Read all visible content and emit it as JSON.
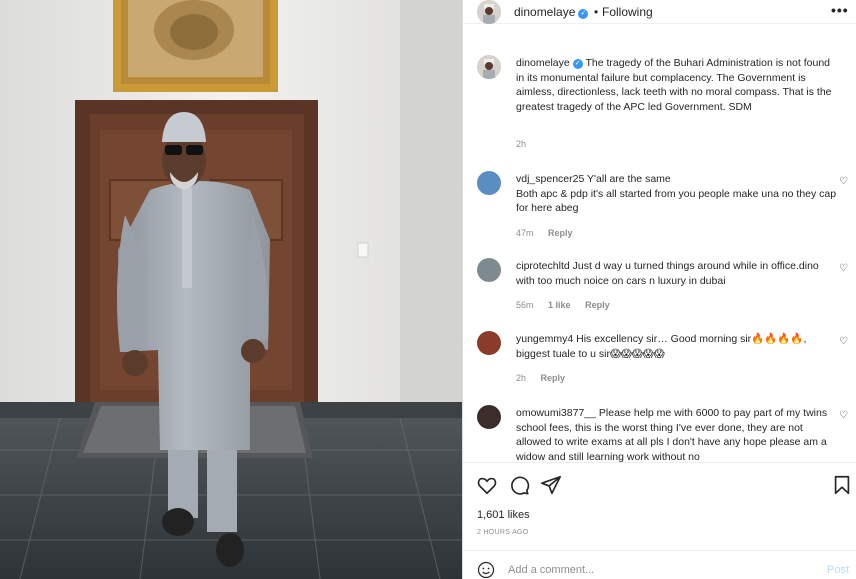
{
  "post": {
    "username": "dinomelaye",
    "separator": "•",
    "follow_status": "Following",
    "more_label": "•••"
  },
  "caption": {
    "username": "dinomelaye",
    "text": "The tragedy of the Buhari Administration is not found in its monumental failure but complacency. The Government is aimless, directionless, lack teeth with no moral compass. That is the greatest tragedy of the APC led Government. SDM",
    "time": "2h"
  },
  "comments": [
    {
      "username": "vdj_spencer25",
      "text": "Y'all are the same\nBoth apc & pdp it's all started from you people make una no they cap for here abeg",
      "time": "47m",
      "likes": "",
      "reply": "Reply",
      "avatar_color": "#5a8ec2"
    },
    {
      "username": "ciprotechltd",
      "text": "Just d way u turned things around while in office.dino with too much noice on cars n luxury in dubai",
      "time": "56m",
      "likes": "1 like",
      "reply": "Reply",
      "avatar_color": "#7d8a8f"
    },
    {
      "username": "yungemmy4",
      "text": "His excellency sir… Good morning sir🔥🔥🔥🔥, biggest tuale to u sir😱😱😱😱😱",
      "time": "2h",
      "likes": "",
      "reply": "Reply",
      "avatar_color": "#8a3b2a"
    },
    {
      "username": "omowumi3877__",
      "text": "Please help me with 6000 to pay part of my twins school fees, this is the worst thing I've ever done, they are not allowed to write exams at all pls I don't have any hope please am a widow and still learning work without no",
      "time": "",
      "likes": "",
      "reply": "",
      "avatar_color": "#3b2e2a"
    }
  ],
  "actions": {
    "likes": "1,601 likes",
    "timestamp": "2 HOURS AGO",
    "comment_placeholder": "Add a comment...",
    "post_label": "Post"
  },
  "colors": {
    "accent": "#3897f0",
    "post_disabled": "#b3dbff",
    "muted": "#8e8e8e",
    "text": "#262626"
  },
  "icons": [
    "heart-icon",
    "comment-icon",
    "share-icon",
    "bookmark-icon",
    "emoji-icon",
    "verified-badge-icon",
    "more-options-icon"
  ]
}
